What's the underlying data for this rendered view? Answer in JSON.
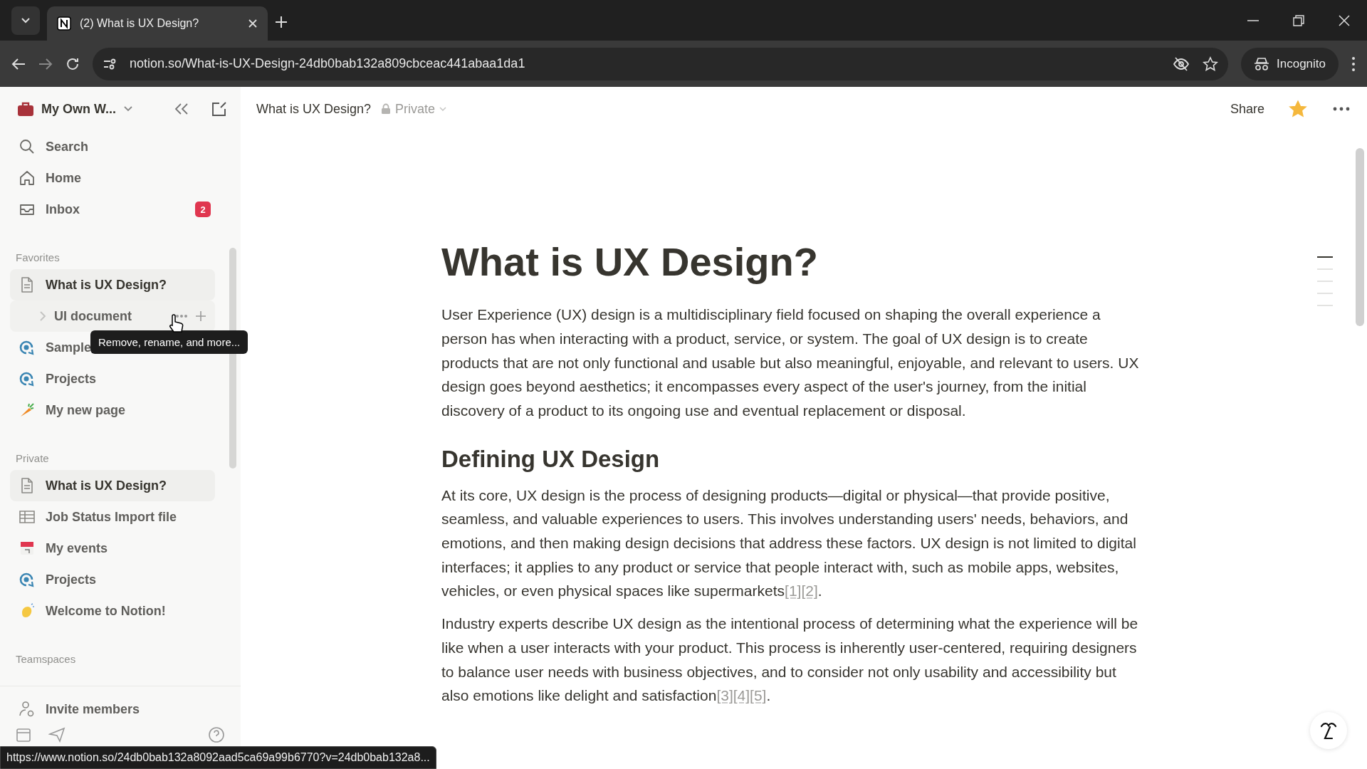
{
  "browser": {
    "tab_title": "(2) What is UX Design?",
    "url": "notion.so/What-is-UX-Design-24db0bab132a809cbceac441abaa1da1",
    "profile": "Incognito"
  },
  "sidebar": {
    "workspace": "My Own W...",
    "nav": [
      {
        "label": "Search",
        "kind": "search"
      },
      {
        "label": "Home",
        "kind": "home"
      },
      {
        "label": "Inbox",
        "kind": "inbox",
        "badge": "2"
      }
    ],
    "sections": [
      {
        "title": "Favorites",
        "items": [
          {
            "label": "What is UX Design?",
            "kind": "page",
            "selected": true,
            "children": [
              {
                "label": "UI document",
                "expanded": false,
                "hovered": true
              }
            ]
          },
          {
            "label": "Sample",
            "kind": "target",
            "selected": false
          },
          {
            "label": "Projects",
            "kind": "target",
            "selected": false
          },
          {
            "label": "My new page",
            "kind": "carrot",
            "selected": false
          }
        ]
      },
      {
        "title": "Private",
        "items": [
          {
            "label": "What is UX Design?",
            "kind": "page",
            "selected": true
          },
          {
            "label": "Job Status Import file",
            "kind": "table",
            "selected": false
          },
          {
            "label": "My events",
            "kind": "calendar",
            "selected": false
          },
          {
            "label": "Projects",
            "kind": "target",
            "selected": false
          },
          {
            "label": "Welcome to Notion!",
            "kind": "wave",
            "selected": false
          }
        ]
      },
      {
        "title": "Teamspaces"
      }
    ],
    "invite": "Invite members",
    "tooltip": "Remove, rename, and more..."
  },
  "header": {
    "breadcrumb": "What is UX Design?",
    "privacy": "Private",
    "share": "Share",
    "starred": true
  },
  "page": {
    "title": "What is UX Design?",
    "blocks": [
      {
        "kind": "paragraph",
        "text": "User Experience (UX) design is a multidisciplinary field focused on shaping the overall experience a person has when interacting with a product, service, or system. The goal of UX design is to create products that are not only functional and usable but also meaningful, enjoyable, and relevant to users. UX design goes beyond aesthetics; it encompasses every aspect of the user's journey, from the initial discovery of a product to its ongoing use and eventual replacement or disposal."
      },
      {
        "kind": "heading",
        "text": "Defining UX Design"
      },
      {
        "kind": "paragraph",
        "text": "At its core, UX design is the process of designing products—digital or physical—that provide positive, seamless, and valuable experiences to users. This involves understanding users' needs, behaviors, and emotions, and then making design decisions that address these factors. UX design is not limited to digital interfaces; it applies to any product or service that people interact with, such as mobile apps, websites, vehicles, or even physical spaces like supermarkets",
        "citations": "[1][2]",
        "end": "."
      },
      {
        "kind": "paragraph",
        "text": "Industry experts describe UX design as the intentional process of determining what the experience will be like when a user interacts with your product. This process is inherently user-centered, requiring designers to balance user needs with business objectives, and to consider not only usability and accessibility but also emotions like delight and satisfaction",
        "citations": "[3][4][5]",
        "end": "."
      }
    ],
    "outline": [
      {
        "selected": true
      },
      {
        "selected": false
      },
      {
        "selected": false
      },
      {
        "selected": false
      },
      {
        "selected": false
      }
    ]
  },
  "status_url": "https://www.notion.so/24db0bab132a8092aad5ca69a99b6770?v=24db0bab132a8..."
}
